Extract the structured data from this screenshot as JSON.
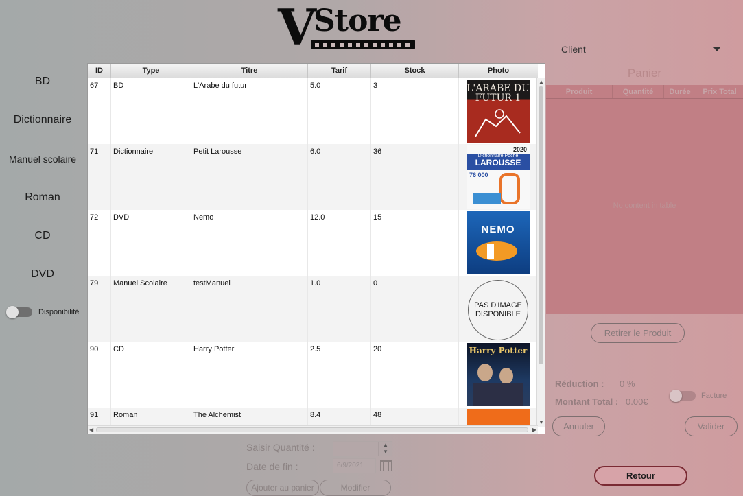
{
  "logo": {
    "v": "V",
    "store": "Store"
  },
  "categories": [
    "BD",
    "Dictionnaire",
    "Manuel scolaire",
    "Roman",
    "CD",
    "DVD"
  ],
  "availability_toggle": {
    "label": "Disponibilité",
    "on": false
  },
  "table": {
    "columns": [
      "ID",
      "Type",
      "Titre",
      "Tarif",
      "Stock",
      "Photo"
    ],
    "rows": [
      {
        "id": "67",
        "type": "BD",
        "titre": "L'Arabe du futur",
        "tarif": "5.0",
        "stock": "3"
      },
      {
        "id": "71",
        "type": "Dictionnaire",
        "titre": "Petit Larousse",
        "tarif": "6.0",
        "stock": "36"
      },
      {
        "id": "72",
        "type": "DVD",
        "titre": "Nemo",
        "tarif": "12.0",
        "stock": "15"
      },
      {
        "id": "79",
        "type": "Manuel Scolaire",
        "titre": "testManuel",
        "tarif": "1.0",
        "stock": "0"
      },
      {
        "id": "90",
        "type": "CD",
        "titre": "Harry Potter",
        "tarif": "2.5",
        "stock": "20"
      },
      {
        "id": "91",
        "type": "Roman",
        "titre": "The Alchemist",
        "tarif": "8.4",
        "stock": "48"
      }
    ],
    "covers": {
      "arabe": "L'ARABE DU FUTUR 1",
      "larousse_year": "2020",
      "larousse_sub": "Dictionnaire Poche",
      "larousse_brand": "LAROUSSE",
      "larousse_count": "76 000",
      "nemo": "NEMO",
      "hp": "Harry Potter"
    },
    "no_image_text": "PAS D'IMAGE DISPONIBLE"
  },
  "form": {
    "quantity_label": "Saisir Quantité :",
    "end_date_label": "Date de fin :",
    "end_date_value": "6/9/2021",
    "add_button": "Ajouter au panier",
    "modify_button": "Modifier"
  },
  "cart": {
    "client_placeholder": "Client",
    "title": "Panier",
    "columns": [
      "Produit",
      "Quantité",
      "Durée",
      "Prix Total"
    ],
    "empty_text": "No content in table",
    "remove_button": "Retirer le Produit",
    "reduction_label": "Réduction :",
    "reduction_value": "0 %",
    "total_label": "Montant Total :",
    "total_value": "0.00€",
    "invoice_toggle_label": "Facture",
    "cancel_button": "Annuler",
    "validate_button": "Valider"
  },
  "back_button": "Retour"
}
